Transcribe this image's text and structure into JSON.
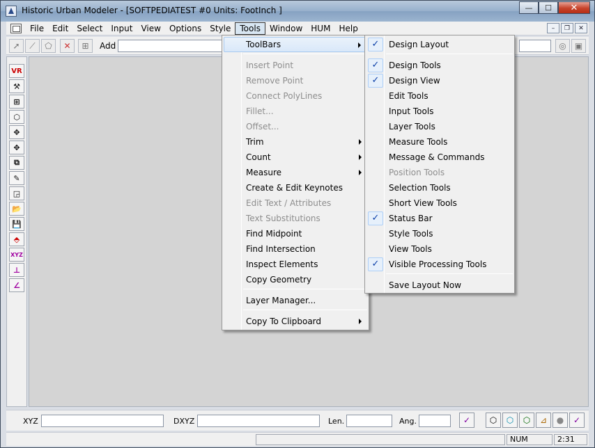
{
  "window": {
    "title": "Historic Urban Modeler - [SOFTPEDIATEST #0  Units: FootInch ]",
    "minimize": "—",
    "maximize": "☐",
    "close": "✕"
  },
  "menubar": {
    "items": [
      "File",
      "Edit",
      "Select",
      "Input",
      "View",
      "Options",
      "Style",
      "Tools",
      "Window",
      "HUM",
      "Help"
    ],
    "mdi": [
      "–",
      "❐",
      "✕"
    ]
  },
  "toolrow": {
    "add_label": "Add"
  },
  "vtoolbar": {
    "buttons": [
      "VR",
      "⚒",
      "⊞",
      "⬡",
      "✥",
      "✥",
      "⧉",
      "✎",
      "◲",
      "📂",
      "💾",
      "⬘",
      "XYZ",
      "⊥",
      "∠"
    ]
  },
  "bottombar": {
    "xyz_label": "XYZ",
    "dxyz_label": "DXYZ",
    "len_label": "Len.",
    "ang_label": "Ang."
  },
  "statusbar": {
    "num": "NUM",
    "time": "2:31"
  },
  "tools_menu": {
    "items": [
      {
        "label": "ToolBars",
        "state": "highlight",
        "submenu": true
      },
      {
        "label": "Insert Point",
        "state": "disabled"
      },
      {
        "label": "Remove Point",
        "state": "disabled"
      },
      {
        "label": "Connect PolyLines",
        "state": "disabled"
      },
      {
        "label": "Fillet...",
        "state": "disabled"
      },
      {
        "label": "Offset...",
        "state": "disabled"
      },
      {
        "label": "Trim",
        "state": "normal",
        "submenu": true
      },
      {
        "label": "Count",
        "state": "normal",
        "submenu": true
      },
      {
        "label": "Measure",
        "state": "normal",
        "submenu": true
      },
      {
        "label": "Create & Edit Keynotes",
        "state": "normal"
      },
      {
        "label": "Edit Text / Attributes",
        "state": "disabled"
      },
      {
        "label": "Text Substitutions",
        "state": "disabled"
      },
      {
        "label": "Find Midpoint",
        "state": "normal"
      },
      {
        "label": "Find Intersection",
        "state": "normal"
      },
      {
        "label": "Inspect Elements",
        "state": "normal"
      },
      {
        "label": "Copy Geometry",
        "state": "normal"
      },
      {
        "label": "Layer Manager...",
        "state": "normal"
      },
      {
        "label": "Copy To Clipboard",
        "state": "normal",
        "submenu": true
      }
    ]
  },
  "toolbars_submenu": {
    "items": [
      {
        "label": "Design Layout",
        "checked": true,
        "state": "normal"
      },
      {
        "label": "Design Tools",
        "checked": true,
        "state": "normal"
      },
      {
        "label": "Design View",
        "checked": true,
        "state": "normal"
      },
      {
        "label": "Edit Tools",
        "checked": false,
        "state": "normal"
      },
      {
        "label": "Input Tools",
        "checked": false,
        "state": "normal"
      },
      {
        "label": "Layer Tools",
        "checked": false,
        "state": "normal"
      },
      {
        "label": "Measure Tools",
        "checked": false,
        "state": "normal"
      },
      {
        "label": "Message & Commands",
        "checked": false,
        "state": "normal"
      },
      {
        "label": "Position Tools",
        "checked": false,
        "state": "disabled"
      },
      {
        "label": "Selection Tools",
        "checked": false,
        "state": "normal"
      },
      {
        "label": "Short View Tools",
        "checked": false,
        "state": "normal"
      },
      {
        "label": "Status Bar",
        "checked": true,
        "state": "normal"
      },
      {
        "label": "Style Tools",
        "checked": false,
        "state": "normal"
      },
      {
        "label": "View Tools",
        "checked": false,
        "state": "normal"
      },
      {
        "label": "Visible Processing Tools",
        "checked": true,
        "state": "normal"
      },
      {
        "label": "Save Layout Now",
        "checked": false,
        "state": "normal"
      }
    ],
    "check_glyph": "✓"
  }
}
